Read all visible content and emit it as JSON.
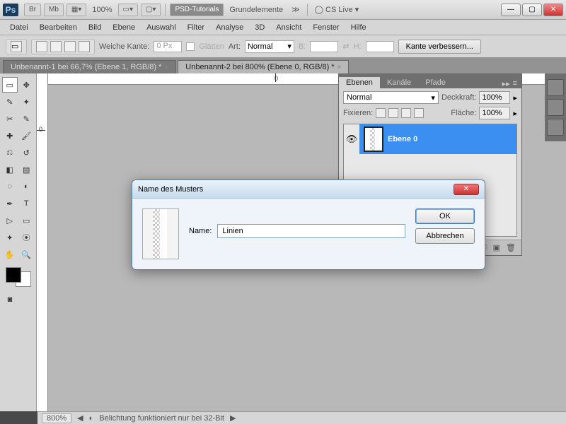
{
  "titlebar": {
    "br": "Br",
    "mb": "Mb",
    "zoom": "100%",
    "psd": "PSD-Tutorials",
    "grund": "Grundelemente",
    "cslive": "CS Live"
  },
  "menu": [
    "Datei",
    "Bearbeiten",
    "Bild",
    "Ebene",
    "Auswahl",
    "Filter",
    "Analyse",
    "3D",
    "Ansicht",
    "Fenster",
    "Hilfe"
  ],
  "optbar": {
    "weiche": "Weiche Kante:",
    "weiche_val": "0 Px",
    "glatten": "Glätten",
    "art": "Art:",
    "art_val": "Normal",
    "b": "B:",
    "h": "H:",
    "verbessern": "Kante verbessern..."
  },
  "tabs": [
    {
      "t": "Unbenannt-1 bei 66,7% (Ebene 1, RGB/8) *",
      "active": false
    },
    {
      "t": "Unbenannt-2 bei 800% (Ebene 0, RGB/8) *",
      "active": true
    }
  ],
  "ruler": {
    "h0": "0",
    "v0": "0"
  },
  "layers": {
    "tabs": [
      "Ebenen",
      "Kanäle",
      "Pfade"
    ],
    "blend": "Normal",
    "deck_label": "Deckkraft:",
    "deck": "100%",
    "fix": "Fixieren:",
    "flache_label": "Fläche:",
    "flache": "100%",
    "layer0": "Ebene 0"
  },
  "dialog": {
    "title": "Name des Musters",
    "name_label": "Name:",
    "name_val": "Linien",
    "ok": "OK",
    "cancel": "Abbrechen"
  },
  "status": {
    "zoom": "800%",
    "msg": "Belichtung funktioniert nur bei 32-Bit"
  }
}
